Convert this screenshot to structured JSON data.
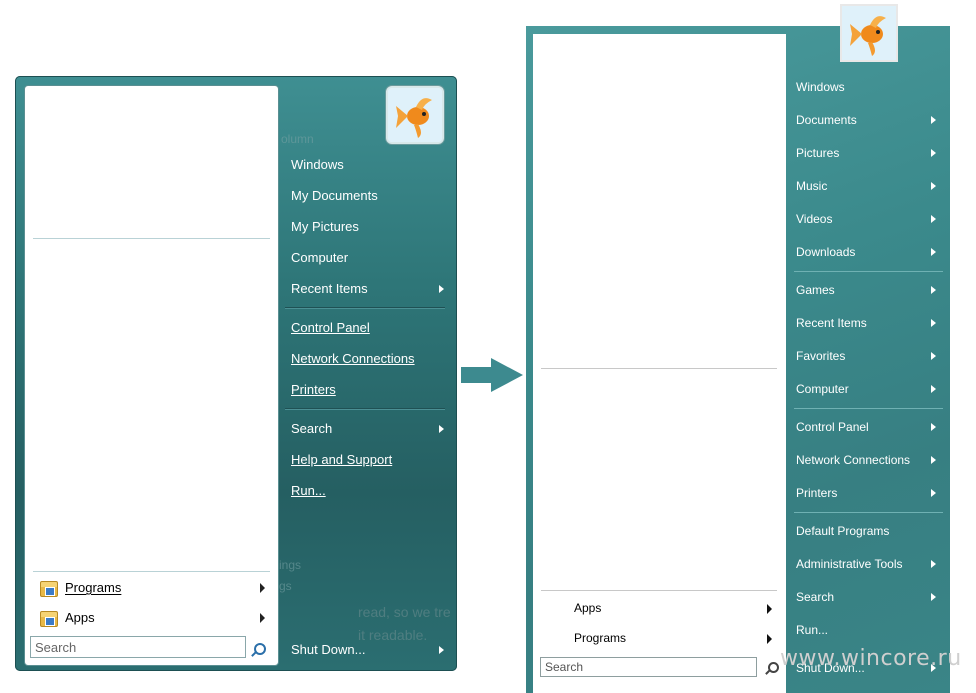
{
  "left_menu": {
    "right_items": [
      {
        "label": "Windows",
        "submenu": false
      },
      {
        "label": "My Documents",
        "submenu": false
      },
      {
        "label": "My Pictures",
        "submenu": false
      },
      {
        "label": "Computer",
        "submenu": false
      },
      {
        "label": "Recent Items",
        "submenu": true
      },
      {
        "label": "Control Panel",
        "submenu": false
      },
      {
        "label": "Network Connections",
        "submenu": false
      },
      {
        "label": "Printers",
        "submenu": false
      },
      {
        "label": "Search",
        "submenu": true
      },
      {
        "label": "Help and Support",
        "submenu": false
      },
      {
        "label": "Run...",
        "submenu": false
      }
    ],
    "programs_label": "Programs",
    "apps_label": "Apps",
    "search_placeholder": "Search",
    "shutdown_label": "Shut Down...",
    "ghost_texts": [
      "olumn",
      "ings",
      "gs",
      "read, so we tre",
      "it readable."
    ]
  },
  "right_menu": {
    "right_items": [
      {
        "label": "Windows",
        "submenu": false
      },
      {
        "label": "Documents",
        "submenu": true
      },
      {
        "label": "Pictures",
        "submenu": true
      },
      {
        "label": "Music",
        "submenu": true
      },
      {
        "label": "Videos",
        "submenu": true
      },
      {
        "label": "Downloads",
        "submenu": true
      },
      {
        "label": "Games",
        "submenu": true
      },
      {
        "label": "Recent Items",
        "submenu": true
      },
      {
        "label": "Favorites",
        "submenu": true
      },
      {
        "label": "Computer",
        "submenu": true
      },
      {
        "label": "Control Panel",
        "submenu": true
      },
      {
        "label": "Network Connections",
        "submenu": true
      },
      {
        "label": "Printers",
        "submenu": true
      },
      {
        "label": "Default Programs",
        "submenu": false
      },
      {
        "label": "Administrative Tools",
        "submenu": true
      },
      {
        "label": "Search",
        "submenu": true
      },
      {
        "label": "Run...",
        "submenu": false
      }
    ],
    "apps_label": "Apps",
    "programs_label": "Programs",
    "search_placeholder": "Search",
    "shutdown_label": "Shut Down..."
  },
  "watermark": "www.wincore.ru",
  "colors": {
    "menu_teal": "#2e7678",
    "menu_teal_light": "#4a9a9c",
    "arrow_teal": "#3d8a8f",
    "text_white": "#ffffff"
  },
  "icons": [
    "user-avatar-goldfish",
    "folder-programs-icon",
    "search-icon",
    "submenu-arrow-icon",
    "transition-arrow-icon"
  ]
}
